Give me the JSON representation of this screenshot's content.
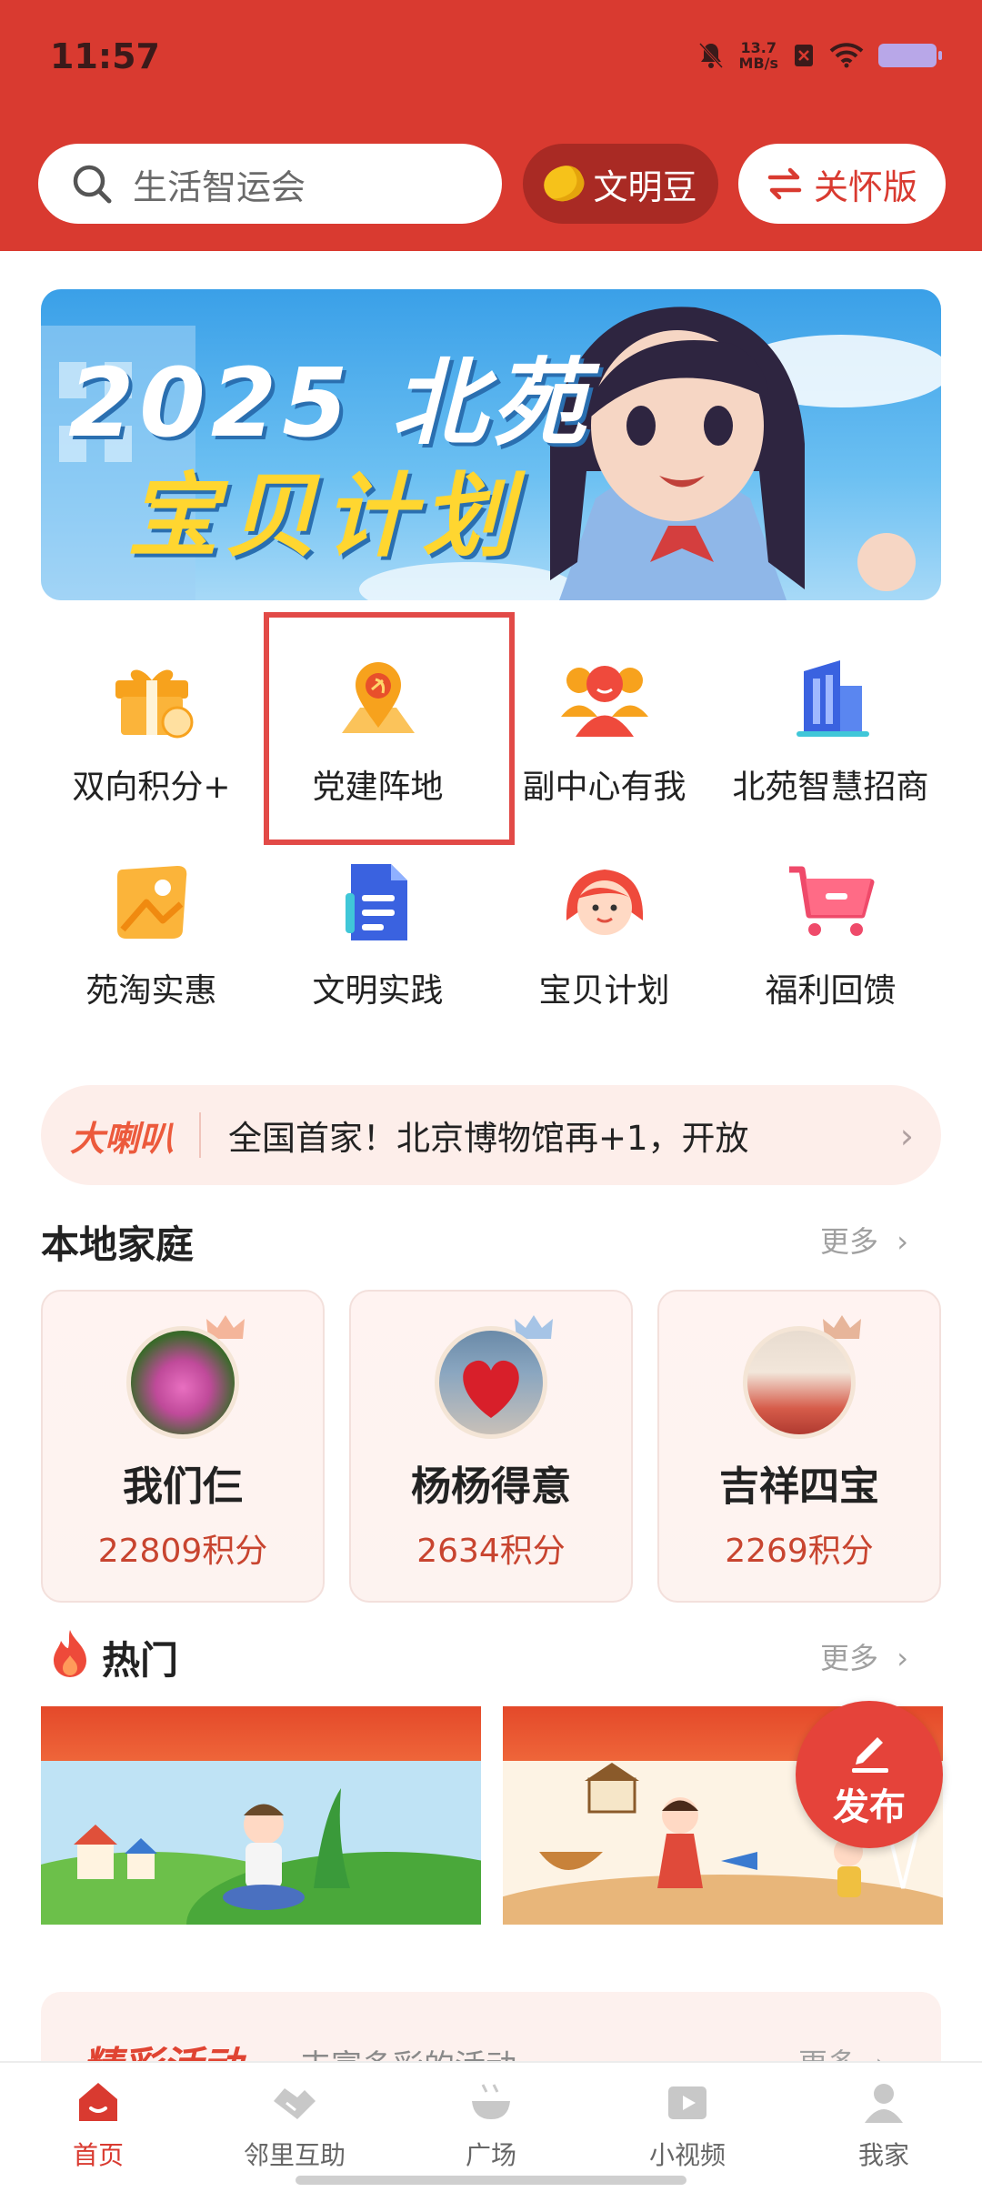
{
  "status_bar": {
    "time": "11:57",
    "speed_value": "13.7",
    "speed_unit": "MB/s"
  },
  "header": {
    "search_placeholder": "生活智运会",
    "bean_label": "文明豆",
    "care_label": "关怀版"
  },
  "banner": {
    "line1": "2025 北苑",
    "line2": "宝贝计划"
  },
  "grid": [
    {
      "label": "双向积分+",
      "icon": "gift-icon"
    },
    {
      "label": "党建阵地",
      "icon": "party-flag-icon"
    },
    {
      "label": "副中心有我",
      "icon": "people-icon"
    },
    {
      "label": "北苑智慧招商",
      "icon": "building-icon"
    },
    {
      "label": "苑淘实惠",
      "icon": "tag-icon"
    },
    {
      "label": "文明实践",
      "icon": "document-icon"
    },
    {
      "label": "宝贝计划",
      "icon": "child-face-icon"
    },
    {
      "label": "福利回馈",
      "icon": "cart-icon"
    }
  ],
  "notice": {
    "tag": "大喇叭",
    "message": "全国首家！北京博物馆再+1，开放"
  },
  "local_families": {
    "title": "本地家庭",
    "more": "更多",
    "cards": [
      {
        "name": "我们仨",
        "points": "22809积分"
      },
      {
        "name": "杨杨得意",
        "points": "2634积分"
      },
      {
        "name": "吉祥四宝",
        "points": "2269积分"
      }
    ]
  },
  "hot": {
    "title": "热门",
    "more": "更多"
  },
  "publish_label": "发布",
  "activity": {
    "title": "精彩活动",
    "subtitle": "丰富多彩的活动",
    "more": "更多"
  },
  "nav": [
    {
      "label": "首页",
      "active": true
    },
    {
      "label": "邻里互助"
    },
    {
      "label": "广场"
    },
    {
      "label": "小视频"
    },
    {
      "label": "我家"
    }
  ],
  "colors": {
    "brand_red": "#d93a30",
    "highlight_box": "#e24a47",
    "points_red": "#c8442f"
  }
}
